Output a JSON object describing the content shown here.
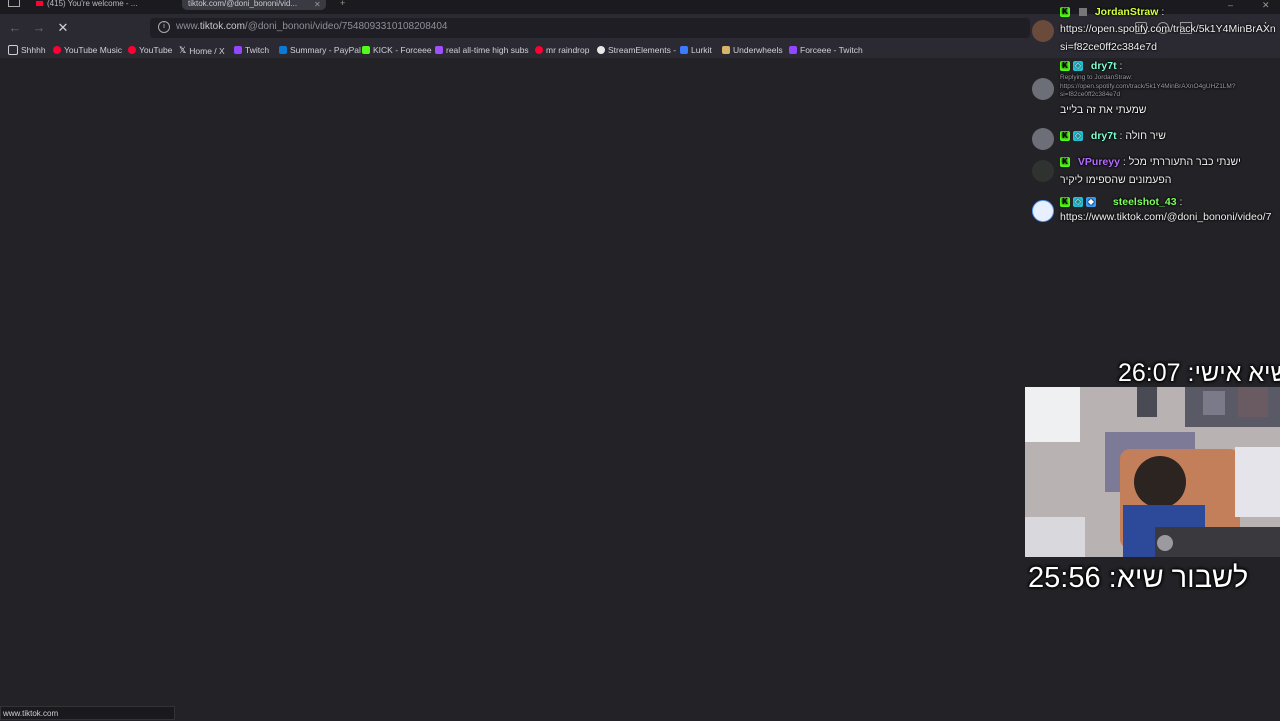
{
  "browser": {
    "tabs": [
      {
        "label": "(415) You're welcome - ..."
      },
      {
        "label": "tiktok.com/@doni_bononi/vid..."
      }
    ],
    "url_prefix": "www.",
    "url_host": "tiktok.com",
    "url_path": "/@doni_bononi/video/7548093310108208404",
    "bookmarks": [
      {
        "label": "Shhhh",
        "icon": "folder-icon",
        "color": "#cfcfcf"
      },
      {
        "label": "YouTube Music",
        "icon": "youtube-music-icon",
        "color": "#ff0033"
      },
      {
        "label": "YouTube",
        "icon": "youtube-icon",
        "color": "#ff0033"
      },
      {
        "label": "Home / X",
        "icon": "x-icon",
        "color": "#ffffff"
      },
      {
        "label": "Twitch",
        "icon": "twitch-icon",
        "color": "#9146ff"
      },
      {
        "label": "Summary - PayPal",
        "icon": "paypal-icon",
        "color": "#0a7ad6"
      },
      {
        "label": "KICK - Forceee",
        "icon": "kick-icon",
        "color": "#53fc18"
      },
      {
        "label": "real all-time high subs",
        "icon": "chart-icon",
        "color": "#a050ff"
      },
      {
        "label": "mr raindrop",
        "icon": "youtube-icon",
        "color": "#ff0033"
      },
      {
        "label": "StreamElements -",
        "icon": "streamelements-icon",
        "color": "#e8e8e8"
      },
      {
        "label": "Lurkit",
        "icon": "lurkit-icon",
        "color": "#3b7bff"
      },
      {
        "label": "Underwheels",
        "icon": "underwheels-icon",
        "color": "#d8b46a"
      },
      {
        "label": "Forceee - Twitch",
        "icon": "twitch-icon",
        "color": "#9146ff"
      }
    ],
    "status_text": "www.tiktok.com"
  },
  "chat": {
    "messages": [
      {
        "username": "JordanStraw",
        "color": "#d6ff3c",
        "lines": [
          "https://open.spotify.com/track/5k1Y4MinBrAXn",
          "si=f82ce0ff2c384e7d"
        ]
      },
      {
        "username": "dry7t",
        "color": "#7fffd4",
        "reply": "Replying to JordanStraw:",
        "reply_text": "https://open.spotify.com/track/5k1Y4MinBrAXnO4gUHZ1LM?si=f82ce0ff2c384e7d",
        "lines": [
          "שמעתי את זה בלייב"
        ]
      },
      {
        "username": "dry7t",
        "color": "#7fffd4",
        "lines": [
          "שיר חולה"
        ]
      },
      {
        "username": "VPureyy",
        "color": "#b36bff",
        "lines": [
          "ישנתי כבר התעוררתי מכל",
          "הפעמונים שהספימו ליקיר"
        ]
      },
      {
        "username": "steelshot_43",
        "color": "#7dff5a",
        "lines": [
          "https://www.tiktok.com/@doni_bononi/video/7"
        ]
      }
    ]
  },
  "overlay": {
    "personal_record_label": "שיא אישי:",
    "personal_record_time": "26:07",
    "break_record_label": "לשבור שיא:",
    "break_record_time": "25:56"
  }
}
